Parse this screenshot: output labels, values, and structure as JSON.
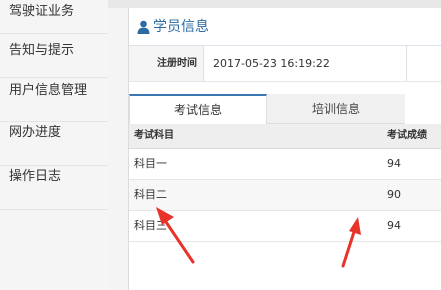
{
  "sidebar": {
    "items": [
      {
        "label": "驾驶证业务"
      },
      {
        "label": "告知与提示"
      },
      {
        "label": "用户信息管理"
      },
      {
        "label": "网办进度"
      },
      {
        "label": "操作日志"
      }
    ]
  },
  "panel": {
    "title": "学员信息",
    "registration": {
      "label": "注册时间",
      "value": "2017-05-23 16:19:22"
    }
  },
  "tabs": [
    {
      "label": "考试信息",
      "active": true
    },
    {
      "label": "培训信息",
      "active": false
    }
  ],
  "table": {
    "headers": {
      "subject": "考试科目",
      "score": "考试成绩"
    },
    "rows": [
      {
        "subject": "科目一",
        "score": "94"
      },
      {
        "subject": "科目二",
        "score": "90"
      },
      {
        "subject": "科目三",
        "score": "94"
      }
    ]
  },
  "colors": {
    "accent": "#2d6ca2",
    "tab_active_border": "#3a78b4",
    "arrow": "#e8332a"
  },
  "icons": {
    "panel_header": "user-icon",
    "annotation": "red-arrow"
  }
}
